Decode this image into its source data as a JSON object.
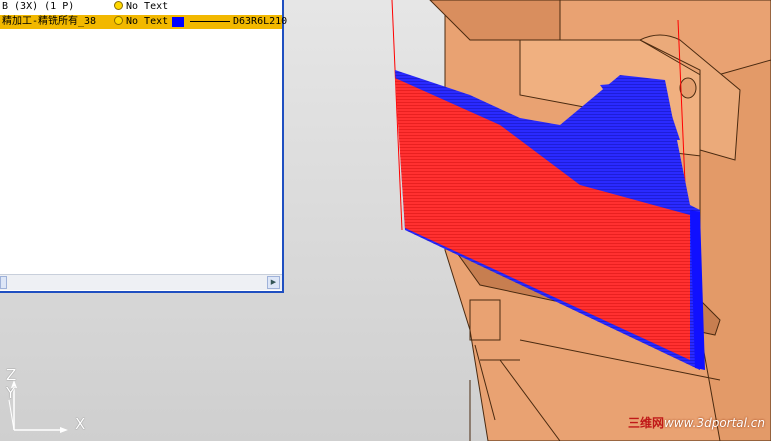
{
  "navigator": {
    "rows": [
      {
        "name": "B (3X) (1 P)",
        "status": "No Text",
        "selected": false
      },
      {
        "name": "精加工-精铣所有_38",
        "status": "No Text",
        "tool": "D63R6L210",
        "swatch_color": "#0000ff",
        "selected": true
      }
    ],
    "selection_color": "#f2b800"
  },
  "axes": {
    "z": "Z",
    "y": "Y",
    "x": "X"
  },
  "watermark": {
    "brand": "三维网",
    "site": "www.3dportal.cn"
  },
  "icons": [
    "lightbulb-icon",
    "scroll-left-arrow-icon",
    "scroll-right-arrow-icon"
  ],
  "colors": {
    "part": "#e8a070",
    "toolpath_red": "#ff2020",
    "toolpath_blue": "#1010ff",
    "background": "#dcdcdc"
  }
}
